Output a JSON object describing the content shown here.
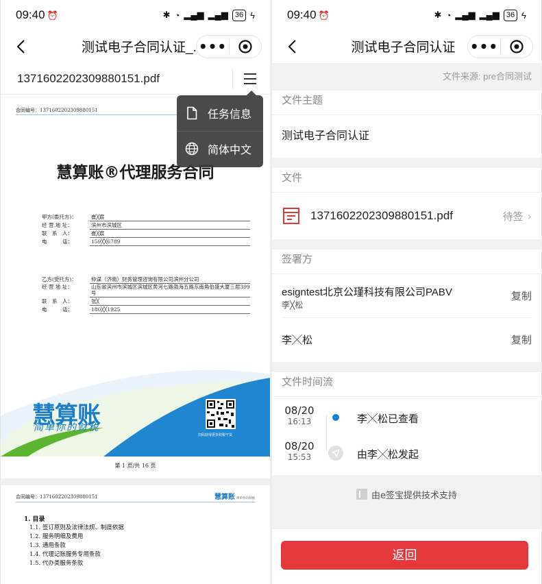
{
  "status_bar": {
    "time": "09:40",
    "alarm_icon": "alarm-icon",
    "battery": "36"
  },
  "left": {
    "nav_title": "测试电子合同认证_...",
    "file_name": "1371602202309880151.pdf",
    "menu": {
      "items": [
        {
          "label": "任务信息",
          "icon": "document-icon"
        },
        {
          "label": "简体中文",
          "icon": "globe-icon"
        }
      ]
    },
    "pdf": {
      "contract_no": "合同编号：1371602202309880151",
      "title": "慧算账®代理服务合同",
      "party_a": {
        "rows": [
          {
            "label": "甲方(委托方)：",
            "value": "崔╳宸"
          },
          {
            "label": "经 营 地 址：",
            "value": "滨州市滨城区"
          },
          {
            "label": "联　系　人：",
            "value": "崔╳宸"
          },
          {
            "label": "电　　　话：",
            "value": "159╳╳6789"
          }
        ]
      },
      "party_b": {
        "rows": [
          {
            "label": "乙方(受托方)：",
            "value": "仲谋（济南）财务管理咨询有限公司滨州分公司"
          },
          {
            "label": "经 营 地 址：",
            "value": "山东省滨州市滨城区滨城区黄河七路渤海五路东南角伯盛大厦三层399号"
          },
          {
            "label": "联　系　人：",
            "value": "张╳"
          },
          {
            "label": "电　　　话：",
            "value": "180╳╳1925"
          }
        ]
      },
      "brand": "慧算账",
      "slogan": "简单你的财税",
      "qr_caption": "扫码获得更多财税干货",
      "page_number": "第 1 页/共 16 页",
      "page2_logo": "慧算账",
      "page2_logo_sub": "简单你的财税",
      "toc_title": "1. 目录",
      "toc": [
        "1.1. 签订原则及法律法规、制度依据",
        "1.2. 服务明细及费用",
        "1.3. 通用条款",
        "1.4. 代理记账服务专用条款",
        "1.5. 代办类服务条款"
      ]
    }
  },
  "right": {
    "nav_title": "测试电子合同认证",
    "source": "文件来源: pre合同测试",
    "subject_header": "文件主题",
    "subject": "测试电子合同认证",
    "file_header": "文件",
    "file_name": "1371602202309880151.pdf",
    "file_status": "待签",
    "signers_header": "签署方",
    "signers": [
      {
        "name": "esigntest北京公瑾科技有限公司PABV",
        "person": "李╳松",
        "copy": "复制"
      },
      {
        "name": "李╳松",
        "copy": "复制"
      }
    ],
    "timeline_header": "文件时间流",
    "timeline": [
      {
        "date": "08/20",
        "time": "16:13",
        "text": "李╳松已查看"
      },
      {
        "date": "08/20",
        "time": "15:53",
        "text": "由李╳松发起"
      }
    ],
    "support": "由e签宝提供技术支持",
    "return_label": "返回"
  },
  "colors": {
    "accent_red": "#e3393d",
    "accent_blue": "#1a7fd8",
    "brand_blue": "#1d7dc9",
    "banner_green": "#5cb531"
  }
}
